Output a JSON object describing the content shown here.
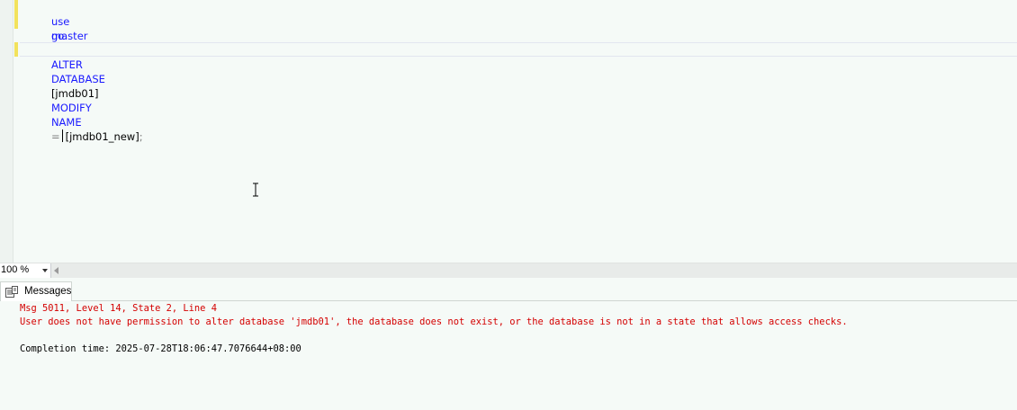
{
  "editor": {
    "line1": {
      "kw": "use",
      "rest": "master"
    },
    "line2": {
      "kw": "go"
    },
    "line4": {
      "kw_alter": "ALTER",
      "kw_database": "DATABASE",
      "db_old": "[jmdb01]",
      "kw_modify": "MODIFY",
      "kw_name": "NAME",
      "op_eq": "=",
      "db_new": "[jmdb01_new]",
      "semicolon": ";"
    }
  },
  "status": {
    "zoom": "100 %"
  },
  "results": {
    "tab_label": "Messages",
    "messages": {
      "error_header": "Msg 5011, Level 14, State 2, Line 4",
      "error_text": "User does not have permission to alter database 'jmdb01', the database does not exist, or the database is not in a state that allows access checks.",
      "completion": "Completion time: 2025-07-28T18:06:47.7076644+08:00"
    }
  },
  "colors": {
    "keyword": "#1a1aff",
    "error": "#d40000",
    "change_marker": "#f2e25c",
    "background": "#f5faf7"
  },
  "icons": [
    "messages-icon",
    "chevron-down-icon",
    "scroll-left-icon",
    "text-cursor-icon"
  ]
}
